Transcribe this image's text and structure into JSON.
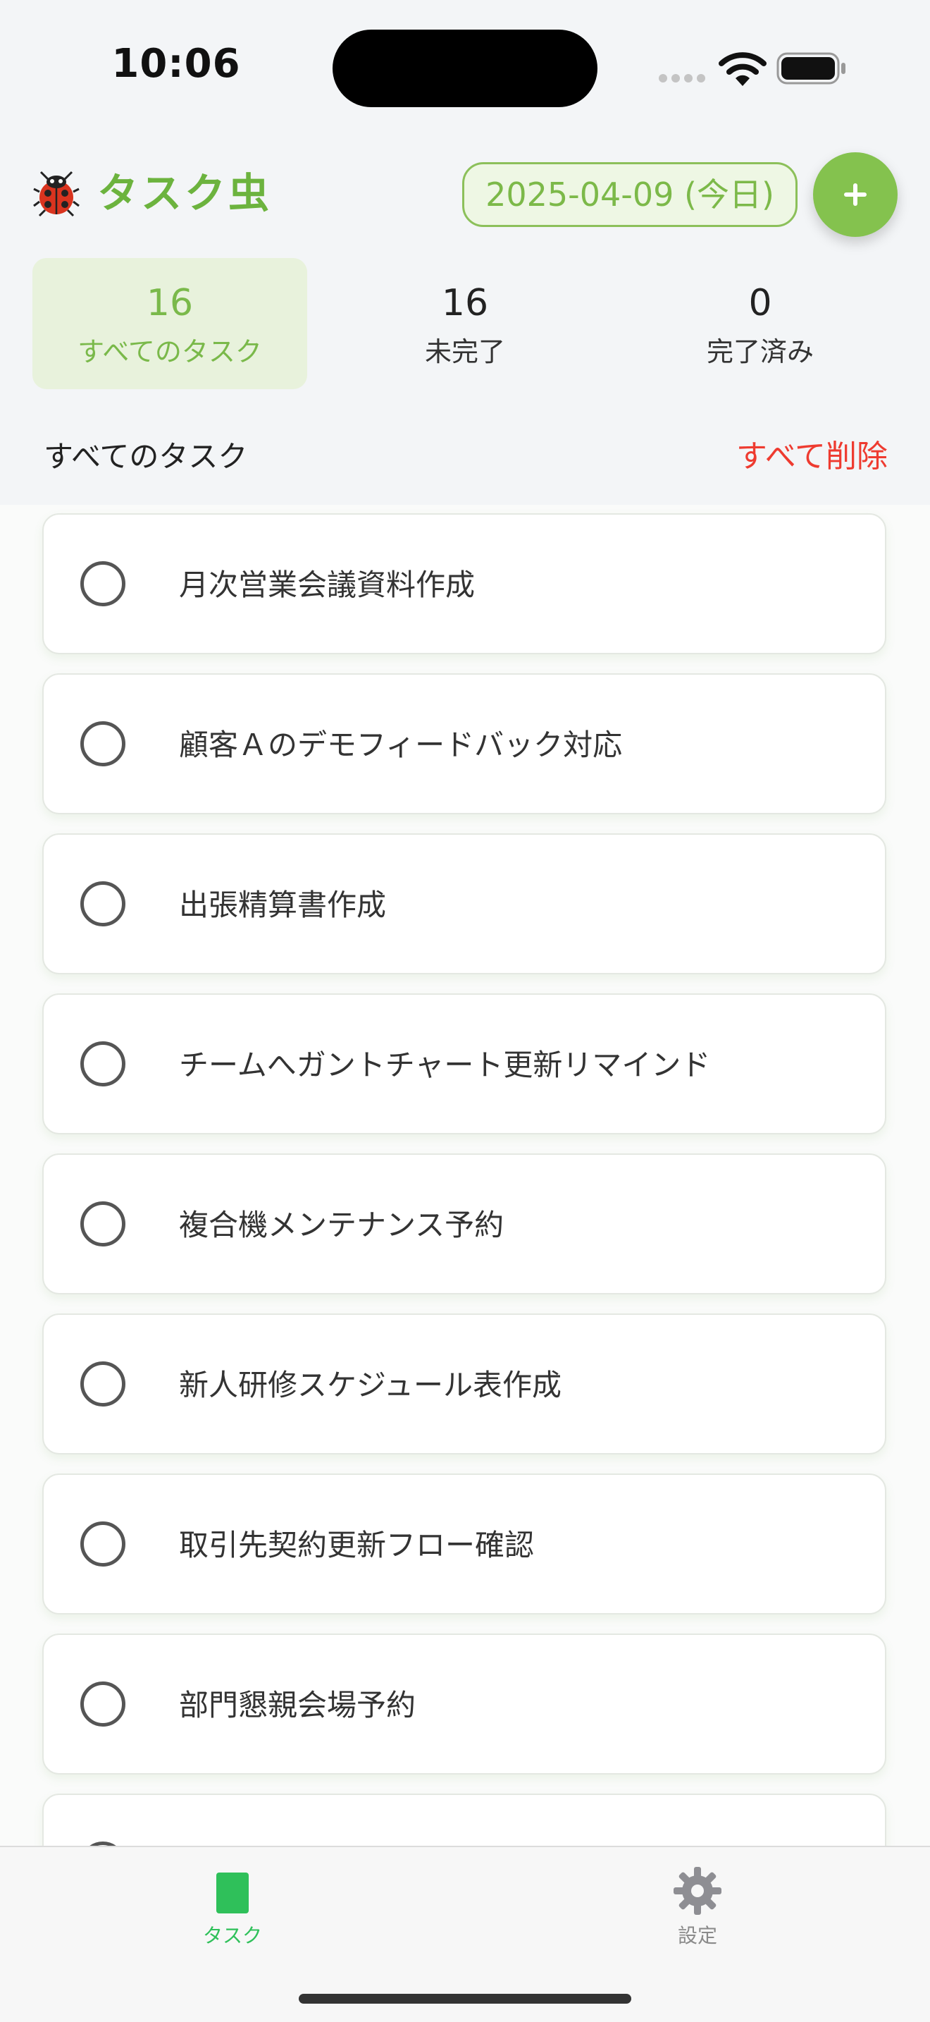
{
  "status_bar": {
    "time": "10:06"
  },
  "header": {
    "app_icon": "ladybug-icon",
    "title": "タスク虫",
    "date_button": "2025-04-09 (今日)",
    "add_button_icon": "plus-icon"
  },
  "stats": [
    {
      "value": "16",
      "label": "すべてのタスク",
      "active": true
    },
    {
      "value": "16",
      "label": "未完了",
      "active": false
    },
    {
      "value": "0",
      "label": "完了済み",
      "active": false
    }
  ],
  "section": {
    "title": "すべてのタスク",
    "delete_all": "すべて削除"
  },
  "tasks": [
    {
      "text": "月次営業会議資料作成",
      "done": false
    },
    {
      "text": "顧客Ａのデモフィードバック対応",
      "done": false
    },
    {
      "text": "出張精算書作成",
      "done": false
    },
    {
      "text": "チームへガントチャート更新リマインド",
      "done": false
    },
    {
      "text": "複合機メンテナンス予約",
      "done": false
    },
    {
      "text": "新人研修スケジュール表作成",
      "done": false
    },
    {
      "text": "取引先契約更新フロー確認",
      "done": false
    },
    {
      "text": "部門懇親会場予約",
      "done": false
    },
    {
      "text": "",
      "done": false
    }
  ],
  "tab_bar": {
    "tabs": [
      {
        "label": "タスク",
        "icon": "task-icon",
        "selected": true
      },
      {
        "label": "設定",
        "icon": "gear-icon",
        "selected": false
      }
    ]
  },
  "colors": {
    "accent_green": "#6cb33e",
    "add_button": "#84c24e",
    "delete_red": "#ee3b30",
    "tab_selected": "#2fc05a"
  }
}
